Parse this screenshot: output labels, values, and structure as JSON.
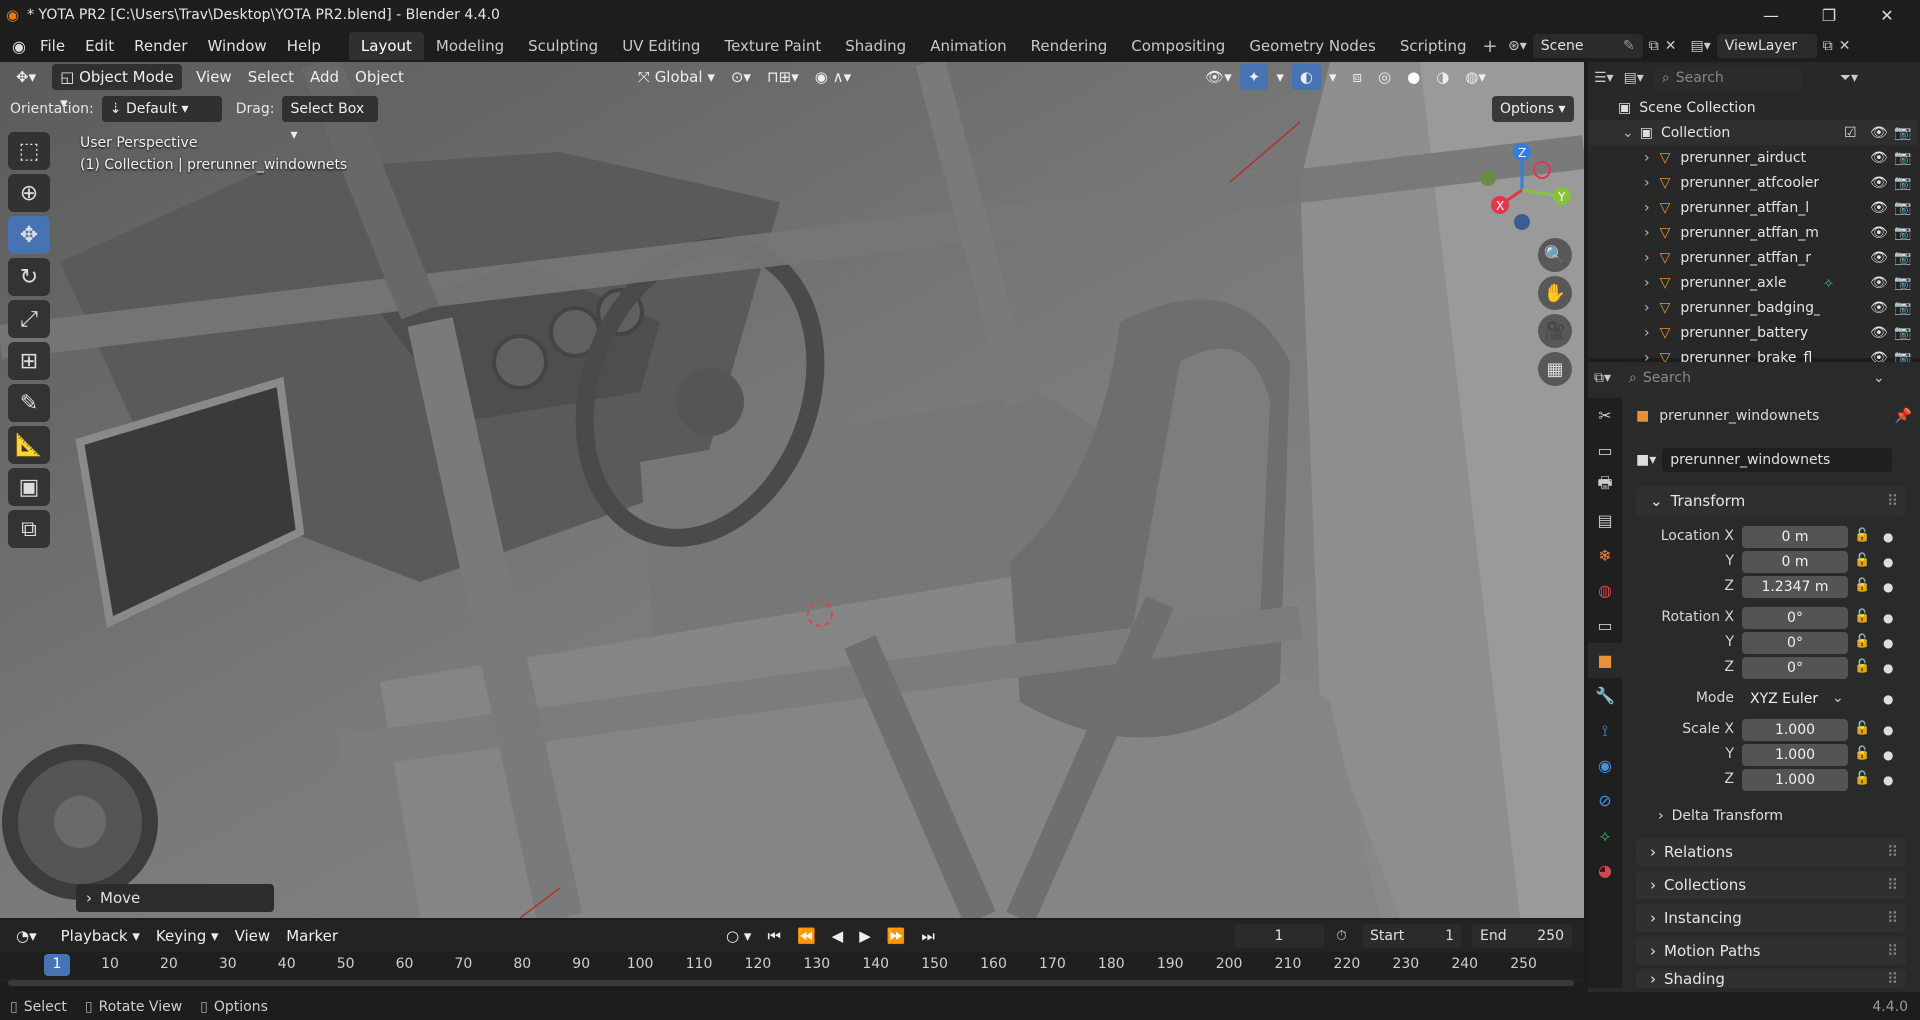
{
  "window": {
    "title": "* YOTA PR2 [C:\\Users\\Trav\\Desktop\\YOTA PR2.blend] - Blender 4.4.0",
    "minimize": "—",
    "maximize": "❐",
    "close": "✕"
  },
  "menu": [
    "File",
    "Edit",
    "Render",
    "Window",
    "Help"
  ],
  "workspaces": [
    "Layout",
    "Modeling",
    "Sculpting",
    "UV Editing",
    "Texture Paint",
    "Shading",
    "Animation",
    "Rendering",
    "Compositing",
    "Geometry Nodes",
    "Scripting"
  ],
  "active_workspace": "Layout",
  "scene": {
    "name": "Scene",
    "viewlayer": "ViewLayer"
  },
  "viewport": {
    "mode": "Object Mode",
    "menus": [
      "View",
      "Select",
      "Add",
      "Object"
    ],
    "transform_orientation": "Global",
    "orientation_label": "Orientation:",
    "orientation_value": "Default",
    "drag_label": "Drag:",
    "drag_value": "Select Box",
    "options": "Options",
    "perspective": "User Perspective",
    "collection_info": "(1) Collection | prerunner_windownets",
    "last_op": "Move",
    "gizmo": {
      "z": "Z",
      "y": "Y",
      "x": "X"
    }
  },
  "timeline": {
    "menus": [
      "Playback",
      "Keying",
      "View",
      "Marker"
    ],
    "current_frame": "1",
    "start_label": "Start",
    "start": "1",
    "end_label": "End",
    "end": "250",
    "ticks": [
      "1",
      "10",
      "20",
      "30",
      "40",
      "50",
      "60",
      "70",
      "80",
      "90",
      "100",
      "110",
      "120",
      "130",
      "140",
      "150",
      "160",
      "170",
      "180",
      "190",
      "200",
      "210",
      "220",
      "230",
      "240",
      "250"
    ]
  },
  "status": {
    "select": "Select",
    "rotate": "Rotate View",
    "options": "Options",
    "version": "4.4.0"
  },
  "outliner": {
    "search_placeholder": "Search",
    "scene_collection": "Scene Collection",
    "collection": "Collection",
    "items": [
      "prerunner_airduct",
      "prerunner_atfcooler",
      "prerunner_atffan_l",
      "prerunner_atffan_m",
      "prerunner_atffan_r",
      "prerunner_axle",
      "prerunner_badging_ca",
      "prerunner_battery",
      "prerunner_brake_fl"
    ]
  },
  "properties": {
    "search_placeholder": "Search",
    "object_name": "prerunner_windownets",
    "datablock": "prerunner_windownets",
    "transform": "Transform",
    "location_label": "Location X",
    "y": "Y",
    "z": "Z",
    "location": [
      "0 m",
      "0 m",
      "1.2347 m"
    ],
    "rotation_label": "Rotation X",
    "rotation": [
      "0°",
      "0°",
      "0°"
    ],
    "mode_label": "Mode",
    "mode": "XYZ Euler",
    "scale_label": "Scale X",
    "scale": [
      "1.000",
      "1.000",
      "1.000"
    ],
    "delta": "Delta Transform",
    "panels": [
      "Relations",
      "Collections",
      "Instancing",
      "Motion Paths",
      "Shading"
    ]
  }
}
